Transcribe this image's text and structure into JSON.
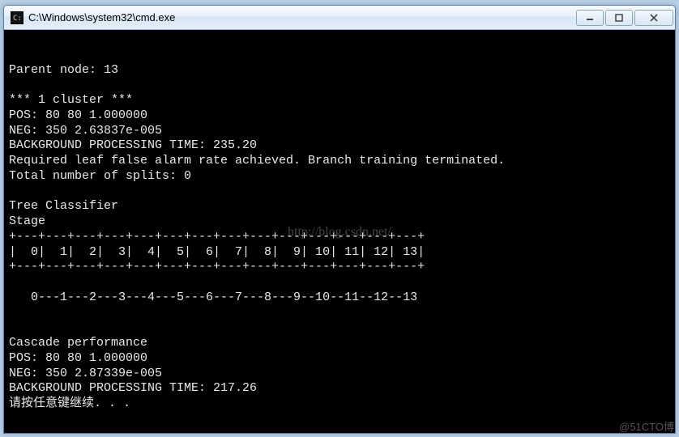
{
  "window": {
    "title": "C:\\Windows\\system32\\cmd.exe"
  },
  "console": {
    "lines": [
      "",
      "",
      "Parent node: 13",
      "",
      "*** 1 cluster ***",
      "POS: 80 80 1.000000",
      "NEG: 350 2.63837e-005",
      "BACKGROUND PROCESSING TIME: 235.20",
      "Required leaf false alarm rate achieved. Branch training terminated.",
      "Total number of splits: 0",
      "",
      "Tree Classifier",
      "Stage",
      "+---+---+---+---+---+---+---+---+---+---+---+---+---+---+",
      "|  0|  1|  2|  3|  4|  5|  6|  7|  8|  9| 10| 11| 12| 13|",
      "+---+---+---+---+---+---+---+---+---+---+---+---+---+---+",
      "",
      "   0---1---2---3---4---5---6---7---8---9--10--11--12--13",
      "",
      "",
      "Cascade performance",
      "POS: 80 80 1.000000",
      "NEG: 350 2.87339e-005",
      "BACKGROUND PROCESSING TIME: 217.26",
      "请按任意键继续. . ."
    ]
  },
  "watermarks": {
    "center": "http://blog.csdn.net/",
    "corner": "@51CTO博"
  }
}
